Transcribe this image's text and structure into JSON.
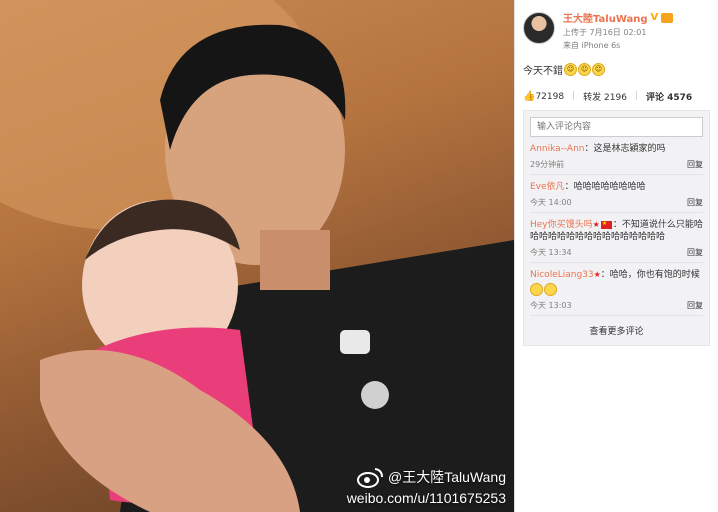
{
  "photo": {
    "watermark_name": "@王大陸TaluWang",
    "watermark_url": "weibo.com/u/1101675253"
  },
  "post": {
    "author": "王大陸TaluWang",
    "verified_mark": "V",
    "upload_time": "上传于 7月16日 02:01",
    "source": "来自 iPhone 6s",
    "text": "今天不錯"
  },
  "stats": {
    "likes": "72198",
    "repost_label": "转发",
    "reposts": "2196",
    "comment_label": "评论",
    "comments": "4576"
  },
  "comment_input": {
    "placeholder": "输入评论内容"
  },
  "comments": [
    {
      "user": "Annika--Ann",
      "text": "：这是林志穎家的吗",
      "time": "29分钟前",
      "reply": "回复"
    },
    {
      "user": "Eve依凡",
      "text": "：哈哈哈哈哈哈哈哈",
      "time": "今天 14:00",
      "reply": "回复"
    },
    {
      "user": "Hey你买馒头吗",
      "text": "：不知道说什么只能哈哈哈哈哈哈哈哈哈哈哈哈哈哈哈哈",
      "time": "今天 13:34",
      "reply": "回复"
    },
    {
      "user": "NicoleLiang33",
      "text": "：哈哈，你也有饱的时候",
      "time": "今天 13:03",
      "reply": "回复"
    }
  ],
  "more_comments": "查看更多评论",
  "colors": {
    "accent": "#eb7350",
    "verified": "#f8a800"
  }
}
